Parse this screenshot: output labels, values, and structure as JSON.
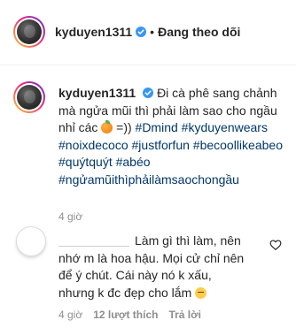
{
  "header": {
    "username": "kyduyen1311",
    "verified_icon": "verified-badge-icon",
    "separator": "•",
    "follow_status": "Đang theo dõi"
  },
  "caption": {
    "username": "kyduyen1311",
    "text_start": "Đi cà phê sang chảnh mà ngửa mũi thì phải làm sao cho ngầu nhỉ các",
    "emoji_icon": "orange-icon",
    "text_end": "=))",
    "hashtags": [
      "#Dmind",
      "#kyduyenwears",
      "#noixdecoco",
      "#justforfun",
      "#becoollikeabeo",
      "#quýtquýt",
      "#abéo",
      "#ngửamũithìphảilàmsaochongầu"
    ],
    "time": "4 giờ"
  },
  "comment": {
    "text": "Làm gì thì làm, nên nhớ m là hoa hậu. Mọi cử chỉ nên để ý chút. Cái này nó k xấu, nhưng k đc đẹp cho lắm",
    "emoji_icon": "pensive-face-icon",
    "like_icon": "heart-outline-icon",
    "time": "4 giờ",
    "likes": "12 lượt thích",
    "reply": "Trả lời"
  },
  "colors": {
    "hashtag": "#00376b",
    "verified": "#3897f0",
    "meta": "#8e8e8e"
  }
}
